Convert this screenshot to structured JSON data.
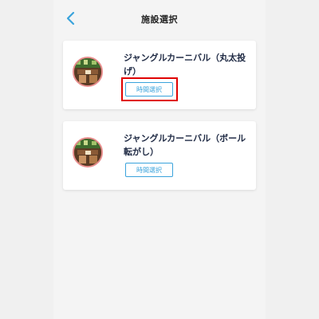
{
  "header": {
    "title": "施設選択"
  },
  "cards": [
    {
      "title": "ジャングルカーニバル（丸太投げ）",
      "button_label": "時間選択",
      "highlighted": true
    },
    {
      "title": "ジャングルカーニバル（ボール転がし）",
      "button_label": "時間選択",
      "highlighted": false
    }
  ],
  "colors": {
    "accent": "#3aa3dc",
    "highlight": "#e00000",
    "thumb_ring": "#e88e8e"
  },
  "icons": {
    "back": "chevron-left-icon"
  }
}
